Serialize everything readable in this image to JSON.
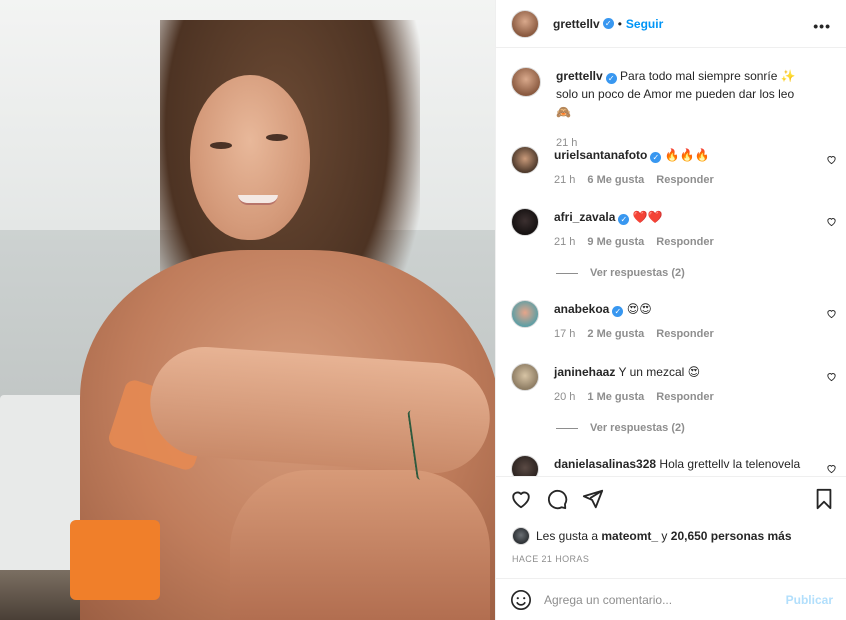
{
  "header": {
    "username": "grettellv",
    "dot": "•",
    "follow_label": "Seguir",
    "more": "•••"
  },
  "caption": {
    "username": "grettellv",
    "text": "Para todo mal siempre sonríe ✨ solo un poco de Amor me pueden dar los leo 🙈",
    "time": "21 h"
  },
  "comments": [
    {
      "username": "urielsantanafoto",
      "text": "🔥🔥🔥",
      "time": "21 h",
      "likes": "6 Me gusta",
      "reply": "Responder",
      "verified": true
    },
    {
      "username": "afri_zavala",
      "text": "❤️❤️",
      "time": "21 h",
      "likes": "9 Me gusta",
      "reply": "Responder",
      "verified": true,
      "replies": "Ver respuestas (2)"
    },
    {
      "username": "anabekoa",
      "text": "😍😍",
      "time": "17 h",
      "likes": "2 Me gusta",
      "reply": "Responder",
      "verified": true
    },
    {
      "username": "janinehaaz",
      "text": "Y un mezcal 😍",
      "time": "20 h",
      "likes": "1 Me gusta",
      "reply": "Responder",
      "verified": false,
      "replies": "Ver respuestas (2)"
    },
    {
      "username": "danielasalinas328",
      "text": "Hola grettellv la telenovela",
      "verified": false
    }
  ],
  "likes": {
    "prefix": "Les gusta a",
    "user": "mateomt_",
    "connector": "y",
    "count": "20,650 personas más"
  },
  "timestamp": "HACE 21 HORAS",
  "add_comment": {
    "placeholder": "Agrega un comentario...",
    "publish": "Publicar"
  },
  "colors": {
    "accent": "#0095f6",
    "verified": "#3897f0",
    "muted": "#8e8e8e"
  }
}
